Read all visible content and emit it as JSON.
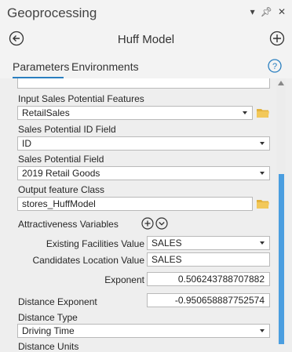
{
  "window": {
    "title": "Geoprocessing",
    "pin_glyph": "▾ —1",
    "close_glyph": "✕"
  },
  "tool": {
    "title": "Huff Model"
  },
  "tabs": [
    {
      "label": "Parameters"
    },
    {
      "label": "Environments"
    }
  ],
  "params": {
    "input_sales": {
      "label": "Input Sales Potential Features",
      "value": "RetailSales"
    },
    "sales_id": {
      "label": "Sales Potential ID Field",
      "value": "ID"
    },
    "sales_field": {
      "label": "Sales Potential Field",
      "value": "2019 Retail Goods"
    },
    "output_class": {
      "label": "Output feature Class",
      "value": "stores_HuffModel"
    },
    "attractiveness": {
      "label": "Attractiveness Variables"
    },
    "existing": {
      "label": "Existing Facilities Value",
      "value": "SALES"
    },
    "candidates": {
      "label": "Candidates Location Value",
      "value": "SALES"
    },
    "exponent": {
      "label": "Exponent",
      "value": "0.506243788707882"
    },
    "distance_exponent": {
      "label": "Distance Exponent",
      "value": "-0.950658887752574"
    },
    "distance_type": {
      "label": "Distance Type",
      "value": "Driving Time"
    },
    "distance_units_partial": {
      "label": "Distance Units"
    }
  },
  "colors": {
    "accent": "#2a7fc0",
    "folder": "#e3b23c",
    "scroll_thumb": "#4a9ee0"
  }
}
